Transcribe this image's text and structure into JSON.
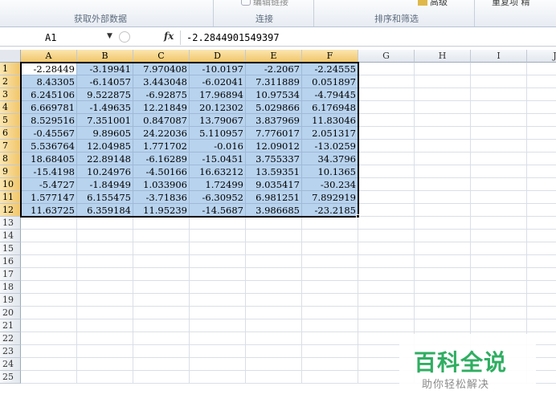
{
  "ribbon": {
    "groups": [
      {
        "label": "获取外部数据"
      },
      {
        "label": "连接"
      },
      {
        "label": "排序和筛选"
      }
    ],
    "edit_links_label": "编辑链接",
    "advanced_label": "高级",
    "reapply_label": "重复项 精"
  },
  "formula_bar": {
    "name_box": "A1",
    "fx_label": "fx",
    "content": "-2.2844901549397"
  },
  "columns": [
    "A",
    "B",
    "C",
    "D",
    "E",
    "F",
    "G",
    "H",
    "I",
    "J"
  ],
  "rows": [
    "1",
    "2",
    "3",
    "4",
    "5",
    "6",
    "7",
    "8",
    "9",
    "10",
    "11",
    "12",
    "13",
    "14",
    "15",
    "16",
    "17",
    "18",
    "19",
    "20",
    "21",
    "22",
    "23",
    "24",
    "25"
  ],
  "cells": [
    [
      "-2.28449",
      "-3.19941",
      "7.970408",
      "-10.0197",
      "-2.2067",
      "-2.24555"
    ],
    [
      "8.43305",
      "-6.14057",
      "3.443048",
      "-6.02041",
      "7.311889",
      "0.051897"
    ],
    [
      "6.245106",
      "9.522875",
      "-6.92875",
      "17.96894",
      "10.97534",
      "-4.79445"
    ],
    [
      "6.669781",
      "-1.49635",
      "12.21849",
      "20.12302",
      "5.029866",
      "6.176948"
    ],
    [
      "8.529516",
      "7.351001",
      "0.847087",
      "13.79067",
      "3.837969",
      "11.83046"
    ],
    [
      "-0.45567",
      "9.89605",
      "24.22036",
      "5.110957",
      "7.776017",
      "2.051317"
    ],
    [
      "5.536764",
      "12.04985",
      "1.771702",
      "-0.016",
      "12.09012",
      "-13.0259"
    ],
    [
      "18.68405",
      "22.89148",
      "-6.16289",
      "-15.0451",
      "3.755337",
      "34.3796"
    ],
    [
      "-15.4198",
      "10.24976",
      "-4.50166",
      "16.63212",
      "13.59351",
      "10.1365"
    ],
    [
      "-5.4727",
      "-1.84949",
      "1.033906",
      "1.72499",
      "9.035417",
      "-30.234"
    ],
    [
      "1.577147",
      "6.155475",
      "-3.71836",
      "-6.30952",
      "6.981251",
      "7.892919"
    ],
    [
      "11.63725",
      "6.359184",
      "11.95239",
      "-14.5687",
      "3.986685",
      "-23.2185"
    ]
  ],
  "watermark": {
    "title": "百科全说",
    "subtitle": "助你轻松解决"
  },
  "colors": {
    "selection_fill": "#b8d3ee",
    "header_selected": "#f1c66a",
    "watermark_green": "#2fae61"
  }
}
